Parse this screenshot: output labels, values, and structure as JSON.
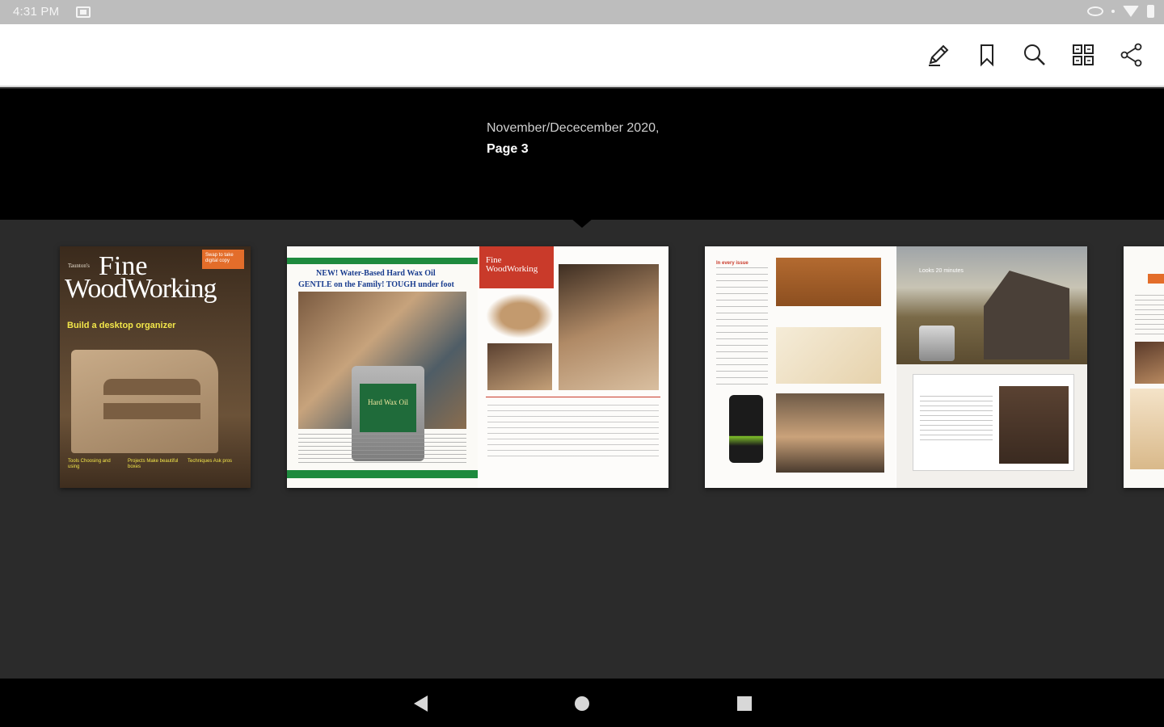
{
  "status_bar": {
    "time": "4:31 PM"
  },
  "toolbar": {
    "icons": [
      "annotate-pencil-icon",
      "bookmark-icon",
      "search-icon",
      "page-layout-icon",
      "share-icon"
    ]
  },
  "issue_info": {
    "date": "November/Dececember 2020,",
    "page": "Page 3"
  },
  "thumbnails": {
    "cover": {
      "small_text": "Taunton's",
      "title_line1": "Fine",
      "title_line2": "WoodWorking",
      "badge": "Swap to take digital copy",
      "headline": "Build a desktop organizer",
      "footer": [
        "Tools Choosing and using",
        "Projects Make beautiful boxes",
        "Techniques Ask pros"
      ]
    },
    "spread1": {
      "ad_line1": "NEW! Water-Based Hard Wax Oil",
      "ad_line2": "GENTLE on the Family! TOUGH under foot",
      "can_label": "Hard Wax Oil",
      "logo": "Fine WoodWorking"
    },
    "spread2": {
      "left_heading": "In every issue",
      "barn_text": "Looks 20 minutes"
    }
  },
  "colors": {
    "toolbar_bg": "#ffffff",
    "info_bg": "#000000",
    "strip_bg": "#2b2b2b",
    "accent_orange": "#e36d2a",
    "accent_red": "#c93a2a",
    "accent_green": "#1e8a3e"
  }
}
